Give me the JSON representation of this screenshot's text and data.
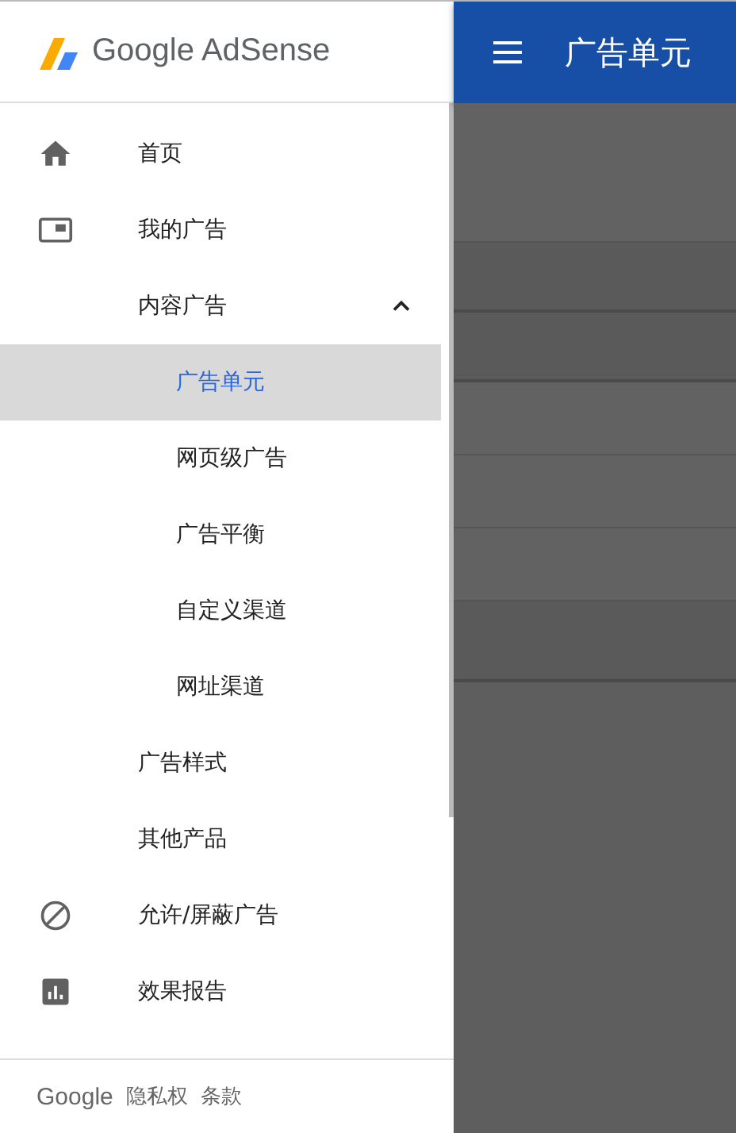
{
  "drawer": {
    "logo_text": "Google AdSense",
    "nav_items": [
      {
        "kind": "home",
        "label": "首页",
        "selected": false
      },
      {
        "kind": "ad",
        "label": "我的广告",
        "selected": false
      },
      {
        "kind": "plain",
        "label": "内容广告",
        "selected": false,
        "expanded": true,
        "children": [
          {
            "label": "广告单元",
            "selected": true
          },
          {
            "label": "网页级广告",
            "selected": false
          },
          {
            "label": "广告平衡",
            "selected": false
          },
          {
            "label": "自定义渠道",
            "selected": false
          },
          {
            "label": "网址渠道",
            "selected": false
          }
        ]
      },
      {
        "kind": "plain",
        "label": "广告样式",
        "selected": false
      },
      {
        "kind": "plain",
        "label": "其他产品",
        "selected": false
      },
      {
        "kind": "block",
        "label": "允许/屏蔽广告",
        "selected": false
      },
      {
        "kind": "report",
        "label": "效果报告",
        "selected": false
      }
    ],
    "footer": {
      "brand": "Google",
      "links": [
        "隐私权",
        "条款"
      ]
    }
  },
  "app_bar": {
    "title": "广告单元"
  }
}
